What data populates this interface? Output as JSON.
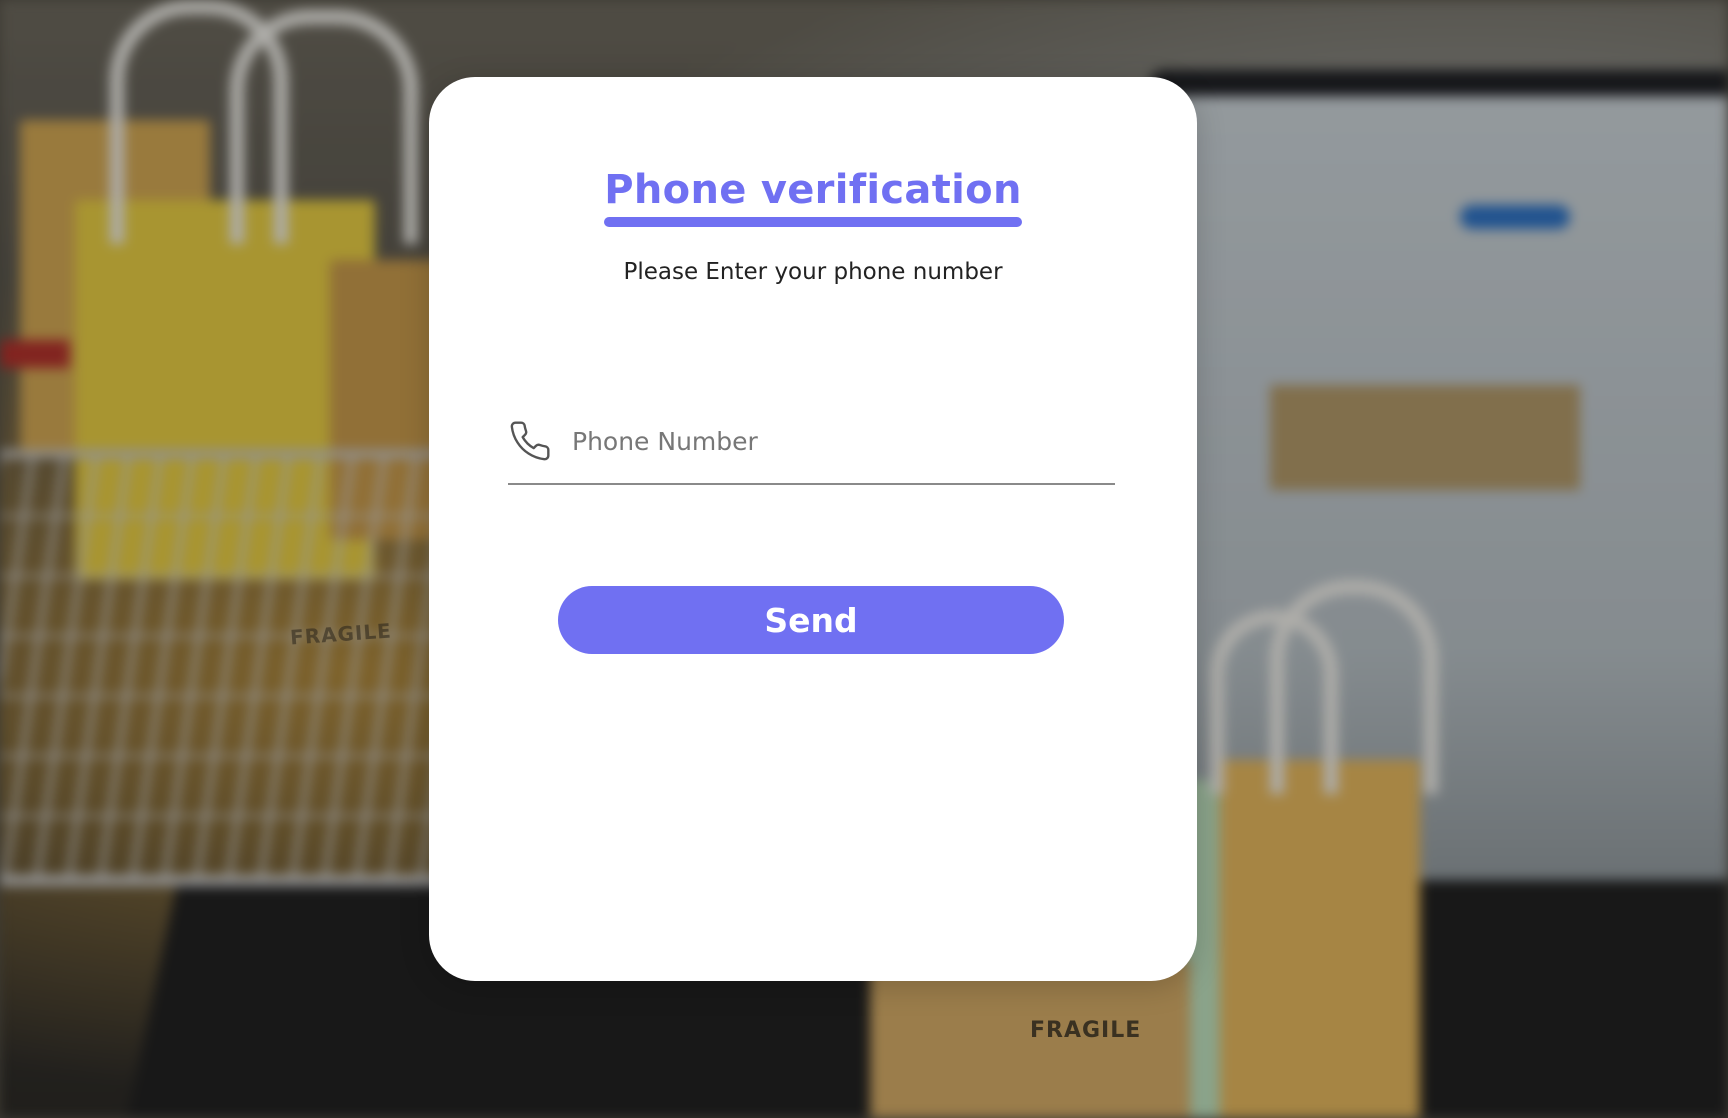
{
  "background": {
    "description_icon": "shopping-cart-photo",
    "fragile_label_right": "FRAGILE",
    "fragile_label_left": "FRAGILE"
  },
  "card": {
    "title": "Phone verification",
    "subtitle": "Please Enter your phone number",
    "phone_field": {
      "icon": "phone-icon",
      "placeholder": "Phone Number",
      "value": ""
    },
    "send_label": "Send"
  },
  "colors": {
    "accent": "#7070f2",
    "card_bg": "#ffffff",
    "text_dark": "#222222",
    "placeholder": "#777777"
  }
}
